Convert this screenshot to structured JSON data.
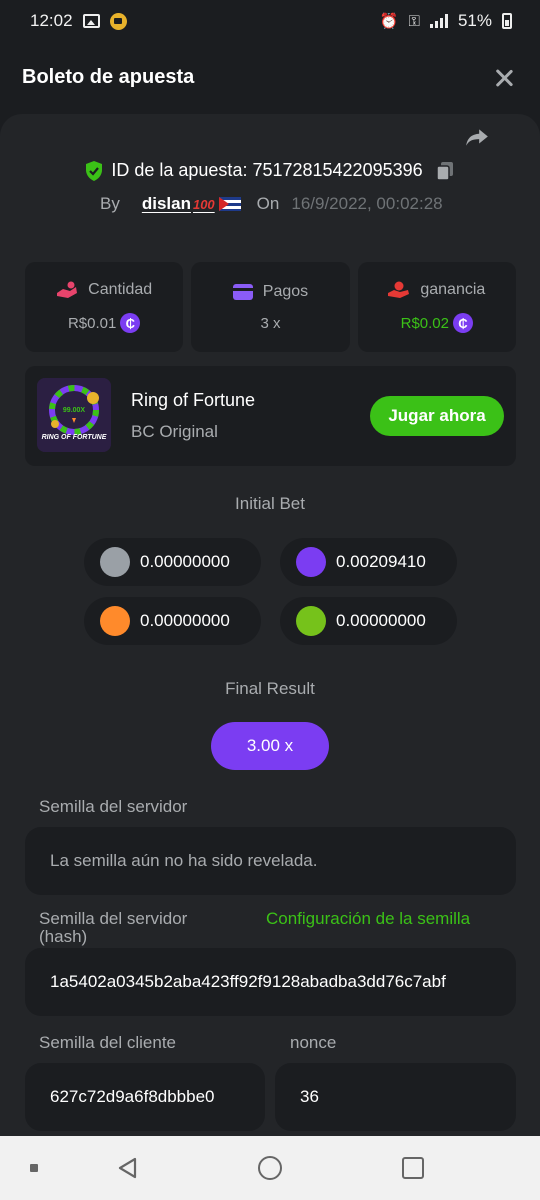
{
  "status_bar": {
    "time": "12:02",
    "battery": "51%"
  },
  "header": {
    "title": "Boleto de apuesta"
  },
  "bet": {
    "id_text": "ID de la apuesta: 75172815422095396",
    "by_label": "By",
    "user": "dislan",
    "user_emoji": "100",
    "on_label": "On",
    "date": "16/9/2022, 00:02:28"
  },
  "stats": [
    {
      "label": "Cantidad",
      "value": "R$0.01",
      "icon": "coins-hand-icon",
      "accent": "#e8446c"
    },
    {
      "label": "Pagos",
      "value": "3 x",
      "icon": "wallet-icon",
      "accent": "#8a5cf6"
    },
    {
      "label": "ganancia",
      "value": "R$0.02",
      "icon": "hand-coin-icon",
      "accent": "#e53935"
    }
  ],
  "game": {
    "name": "Ring of Fortune",
    "provider": "BC Original",
    "play_label": "Jugar ahora",
    "thumb_text": "RING OF FORTUNE",
    "thumb_badge": "99.00X"
  },
  "initial_bet": {
    "title": "Initial Bet",
    "entries": [
      {
        "color": "#9aa0a6",
        "value": "0.00000000"
      },
      {
        "color": "#7b3df2",
        "value": "0.00209410"
      },
      {
        "color": "#ff8a2b",
        "value": "0.00000000"
      },
      {
        "color": "#76c21b",
        "value": "0.00000000"
      }
    ]
  },
  "final_result": {
    "title": "Final Result",
    "value": "3.00 x"
  },
  "server_seed": {
    "label": "Semilla del servidor",
    "value": "La semilla aún no ha sido revelada."
  },
  "server_seed_hash": {
    "label": "Semilla del servidor (hash)",
    "link": "Configuración de la semilla",
    "value": "1a5402a0345b2aba423ff92f9128abadba3dd76c7abf"
  },
  "client_seed": {
    "label": "Semilla del cliente",
    "value": "627c72d9a6f8dbbbe0"
  },
  "nonce": {
    "label": "nonce",
    "value": "36"
  },
  "colors": {
    "green": "#3bc117",
    "purple": "#7b3df2",
    "panel": "#232528",
    "card": "#1b1d20"
  }
}
